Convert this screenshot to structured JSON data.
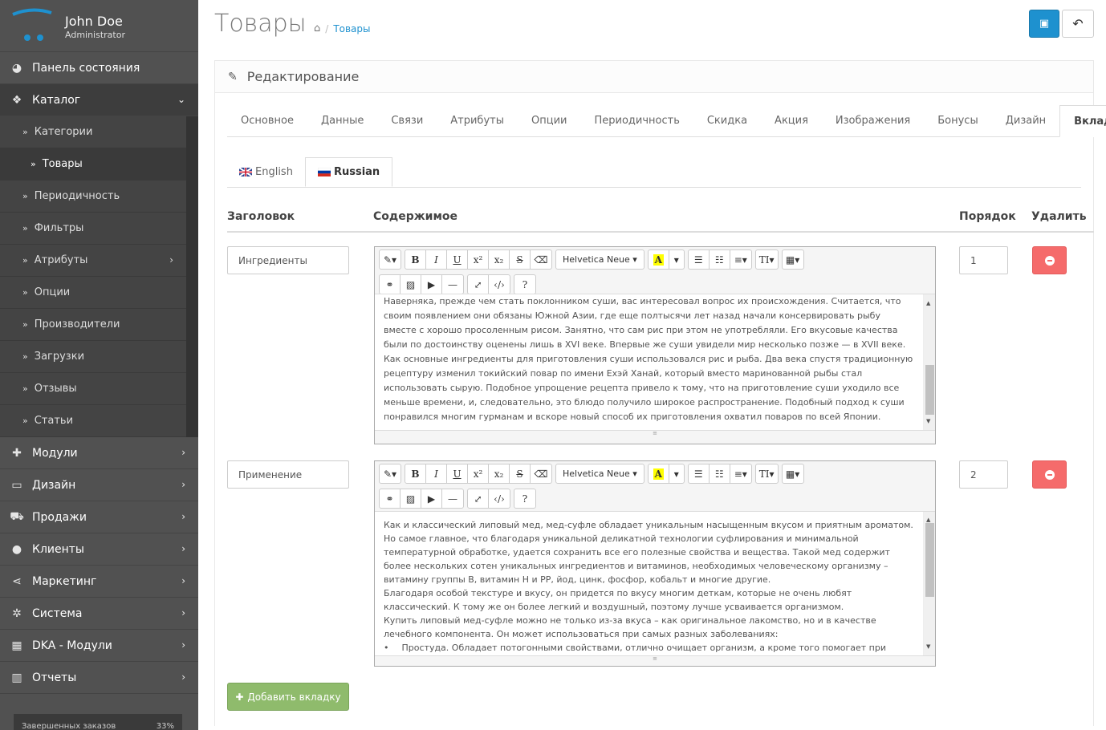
{
  "profile": {
    "name": "John Doe",
    "role": "Administrator"
  },
  "sidebar": {
    "items": [
      {
        "label": "Панель состояния",
        "icon": "dashboard-icon",
        "glyph": "◕"
      },
      {
        "label": "Каталог",
        "icon": "tags-icon",
        "glyph": "❖"
      }
    ],
    "catalog_sub": [
      {
        "label": "Категории"
      },
      {
        "label": "Товары"
      },
      {
        "label": "Периодичность"
      },
      {
        "label": "Фильтры"
      },
      {
        "label": "Атрибуты"
      },
      {
        "label": "Опции"
      },
      {
        "label": "Производители"
      },
      {
        "label": "Загрузки"
      },
      {
        "label": "Отзывы"
      },
      {
        "label": "Статьи"
      }
    ],
    "rest": [
      {
        "label": "Модули",
        "icon": "puzzle-icon",
        "glyph": "✚"
      },
      {
        "label": "Дизайн",
        "icon": "desktop-icon",
        "glyph": "▭"
      },
      {
        "label": "Продажи",
        "icon": "cart-icon",
        "glyph": "⛟"
      },
      {
        "label": "Клиенты",
        "icon": "user-icon",
        "glyph": "●"
      },
      {
        "label": "Маркетинг",
        "icon": "share-icon",
        "glyph": "⋖"
      },
      {
        "label": "Система",
        "icon": "cog-icon",
        "glyph": "✲"
      },
      {
        "label": "DKA - Модули",
        "icon": "grid-icon",
        "glyph": "▦"
      },
      {
        "label": "Отчеты",
        "icon": "bar-chart-icon",
        "glyph": "▥"
      }
    ],
    "progress_label": "Завершенных заказов",
    "progress_value": "33%"
  },
  "header": {
    "title": "Товары",
    "breadcrumb": "Товары"
  },
  "panel": {
    "title": "Редактирование"
  },
  "tabs": [
    "Основное",
    "Данные",
    "Связи",
    "Атрибуты",
    "Опции",
    "Периодичность",
    "Скидка",
    "Акция",
    "Изображения",
    "Бонусы",
    "Дизайн",
    "Вкладки"
  ],
  "lang_tabs": [
    "English",
    "Russian"
  ],
  "columns": {
    "title": "Заголовок",
    "content": "Содержимое",
    "order": "Порядок",
    "delete": "Удалить"
  },
  "toolbar": {
    "font": "Helvetica Neue"
  },
  "rows": [
    {
      "title": "Ингредиенты",
      "order": "1",
      "content": "Наверняка, прежде чем стать поклонником суши, вас интересовал вопрос их происхождения. Считается, что своим появлением они обязаны Южной Азии, где еще полтысячи лет назад начали консервировать рыбу вместе с хорошо просоленным рисом. Занятно, что сам рис при этом не употребляли. Его вкусовые качества были по достоинству оценены лишь в XVI веке. Впервые же суши увидели мир несколько позже — в XVII веке. Как основные ингредиенты для приготовления суши использовался рис и рыба. Два века спустя традиционную рецептуру изменил токийский повар по имени Ехэй Ханай, который вместо маринованной рыбы стал использовать сырую. Подобное упрощение рецепта привело к тому, что на приготовление суши уходило все меньше времени, и, следовательно, это блюдо получило широкое распространение. Подобный подход к суши понравился многим гурманам и вскоре новый способ их приготовления охватил поваров по всей Японии."
    },
    {
      "title": "Применение",
      "order": "2",
      "content_p1": "Как и классический липовый мед, мед-суфле обладает уникальным насыщенным вкусом и приятным ароматом. Но самое главное, что благодаря уникальной деликатной технологии суфлирования и минимальной температурной обработке, удается сохранить все его полезные свойства и вещества. Такой мед содержит более нескольких сотен уникальных ингредиентов и витаминов, необходимых человеческому организму – витамину группы В, витамин Н и РР, йод, цинк, фосфор, кобальт и многие другие.",
      "content_p2": "Благодаря особой текстуре и вкусу, он придется по вкусу многим деткам, которые не очень любят классический. К тому же он более легкий и воздушный, поэтому лучше усваивается организмом.",
      "content_p3": "Купить липовый мед-суфле можно не только из-за вкуса – как оригинальное лакомство, но и в качестве лечебного компонента. Он может использоваться при самых разных заболеваниях:",
      "content_li": "Простуда. Обладает потогонными свойствами, отлично очищает организм, а кроме того помогает при"
    }
  ],
  "add_button": "Добавить вкладку"
}
